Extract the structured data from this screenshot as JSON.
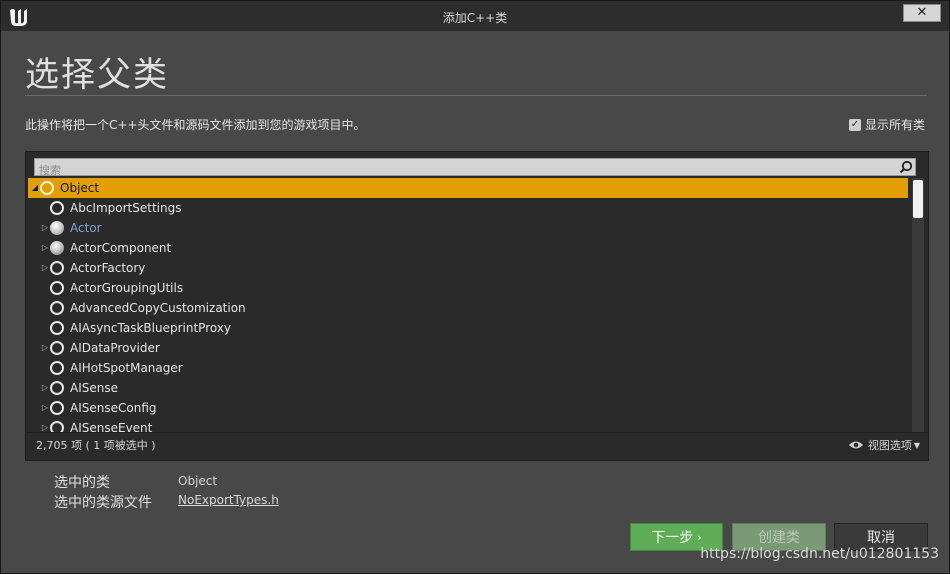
{
  "window": {
    "title": "添加C++类",
    "close_glyph": "✕"
  },
  "header": {
    "page_title": "选择父类",
    "description": "此操作将把一个C++头文件和源码文件添加到您的游戏项目中。",
    "show_all_label": "显示所有类",
    "show_all_checked": true
  },
  "search": {
    "placeholder": "搜索",
    "value": ""
  },
  "class_list": {
    "items": [
      {
        "label": "Object",
        "icon": "ring",
        "expander": "expanded",
        "selected": true,
        "indent": 0
      },
      {
        "label": "AbcImportSettings",
        "icon": "ring",
        "expander": "none",
        "indent": 1
      },
      {
        "label": "Actor",
        "icon": "ball",
        "expander": "collapsed",
        "indent": 1,
        "highlight": "actor"
      },
      {
        "label": "ActorComponent",
        "icon": "comp",
        "expander": "collapsed",
        "indent": 1
      },
      {
        "label": "ActorFactory",
        "icon": "ring",
        "expander": "collapsed",
        "indent": 1
      },
      {
        "label": "ActorGroupingUtils",
        "icon": "ring",
        "expander": "none",
        "indent": 1
      },
      {
        "label": "AdvancedCopyCustomization",
        "icon": "ring",
        "expander": "none",
        "indent": 1
      },
      {
        "label": "AIAsyncTaskBlueprintProxy",
        "icon": "ring",
        "expander": "none",
        "indent": 1
      },
      {
        "label": "AIDataProvider",
        "icon": "ring",
        "expander": "collapsed",
        "indent": 1
      },
      {
        "label": "AIHotSpotManager",
        "icon": "ring",
        "expander": "none",
        "indent": 1
      },
      {
        "label": "AISense",
        "icon": "ring",
        "expander": "collapsed",
        "indent": 1
      },
      {
        "label": "AISenseConfig",
        "icon": "ring",
        "expander": "collapsed",
        "indent": 1
      },
      {
        "label": "AISenseEvent",
        "icon": "ring",
        "expander": "collapsed",
        "indent": 1
      }
    ]
  },
  "status": {
    "count": "2,705 项 ( 1 项被选中 )",
    "view_options": "视图选项"
  },
  "selection": {
    "class_label": "选中的类",
    "class_value": "Object",
    "source_label": "选中的类源文件",
    "source_value": "NoExportTypes.h"
  },
  "buttons": {
    "next": "下一步",
    "create": "创建类",
    "cancel": "取消"
  },
  "watermark": "https://blog.csdn.net/u012801153",
  "colors": {
    "selection": "#e29f05",
    "next_button": "#5fad56",
    "actor_text": "#7fa5d6"
  }
}
